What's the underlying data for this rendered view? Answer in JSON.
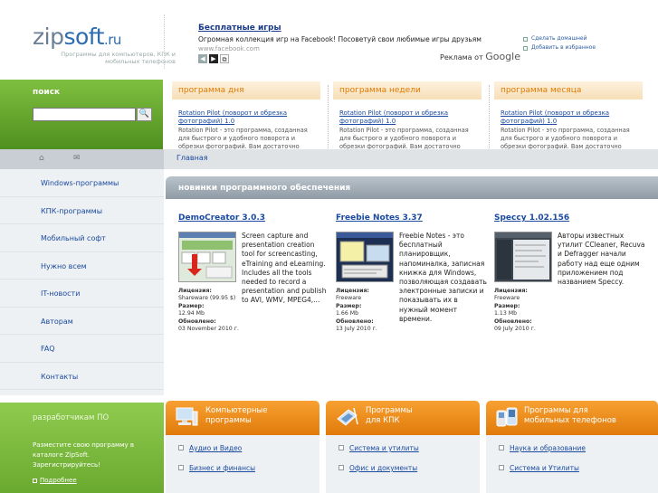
{
  "logo": {
    "prefix": "zip",
    "name": "soft",
    "suffix": ".ru",
    "tagline": "Программы для компьютеров, КПК и мобильных телефонов"
  },
  "ad": {
    "title": "Бесплатные игры",
    "text": "Огромная коллекция игр на Facebook! Посоветуй свои любимые игры друзьям",
    "url": "www.facebook.com",
    "ads_by": "Реклама от",
    "brand": "Google"
  },
  "header_links": {
    "homepage": "Сделать домашней",
    "favorites": "Добавить в избранное"
  },
  "search": {
    "label": "поиск",
    "value": "",
    "placeholder": "",
    "button": "🔍"
  },
  "featured": [
    {
      "heading": "программа дня",
      "title": "Rotation Pilot (поворот и обрезка фотографий) 1.0",
      "desc": "Rotation Pilot - это программа, созданная для быстрого и удобного поворота и обрезки фотографий. Вам достаточно только указать"
    },
    {
      "heading": "программа недели",
      "title": "Rotation Pilot (поворот и обрезка фотографий) 1.0",
      "desc": "Rotation Pilot - это программа, созданная для быстрого и удобного поворота и обрезки фотографий. Вам достаточно только указать"
    },
    {
      "heading": "программа месяца",
      "title": "Rotation Pilot (поворот и обрезка фотографий) 1.0",
      "desc": "Rotation Pilot - это программа, созданная для быстрого и удобного поворота и обрезки фотографий. Вам достаточно только указать"
    }
  ],
  "breadcrumb": "Главная",
  "nav": [
    "Windows-программы",
    "КПК-программы",
    "Мобильный софт",
    "Нужно всем",
    "IT-новости",
    "Авторам",
    "FAQ",
    "Контакты"
  ],
  "developers": {
    "title": "разработчикам ПО",
    "text": "Разместите свою программу в каталоге ZipSoft. Зарегистрируйтесь!",
    "more": "Подробнее"
  },
  "new_software": {
    "heading": "новинки программного обеспечения",
    "programs": [
      {
        "name": "DemoCreator 3.0.3",
        "desc": "Screen capture and presentation creation tool for screencasting, eTraining and eLearning. Includes all the tools needed to record a presentation and publish to AVI, WMV, MPEG4,...",
        "license_label": "Лицензия:",
        "license": "Shareware (99.95 $)",
        "size_label": "Размер:",
        "size": "12.94 Mb",
        "updated_label": "Обновлено:",
        "updated": "03 November 2010 г."
      },
      {
        "name": "Freebie Notes 3.37",
        "desc": "Freebie Notes - это бесплатный планировщик, напоминалка, записная книжка для Windows, позволяющая создавать электронные записки и показывать их в нужный момент времени.",
        "license_label": "Лицензия:",
        "license": "Freeware",
        "size_label": "Размер:",
        "size": "1.66 Mb",
        "updated_label": "Обновлено:",
        "updated": "13 July 2010 г."
      },
      {
        "name": "Speccy 1.02.156",
        "desc": "Авторы известных утилит CCleaner, Recuva и Defragger начали работу над еще одним приложением под названием Speccy.",
        "license_label": "Лицензия:",
        "license": "Freeware",
        "size_label": "Размер:",
        "size": "1.13 Mb",
        "updated_label": "Обновлено:",
        "updated": "09 July 2010 г."
      }
    ]
  },
  "categories": [
    {
      "line1": "Компьютерные",
      "line2": "программы",
      "items": [
        "Аудио и Видео",
        "Бизнес и финансы"
      ]
    },
    {
      "line1": "Программы",
      "line2": "для КПК",
      "items": [
        "Система и утилиты",
        "Офис и документы"
      ]
    },
    {
      "line1": "Программы для",
      "line2": "мобильных телефонов",
      "items": [
        "Наука и образование",
        "Система и Утилиты"
      ]
    }
  ],
  "colors": {
    "green": "#6aa92f",
    "orange": "#f08a1a",
    "link": "#1a4aa0"
  }
}
